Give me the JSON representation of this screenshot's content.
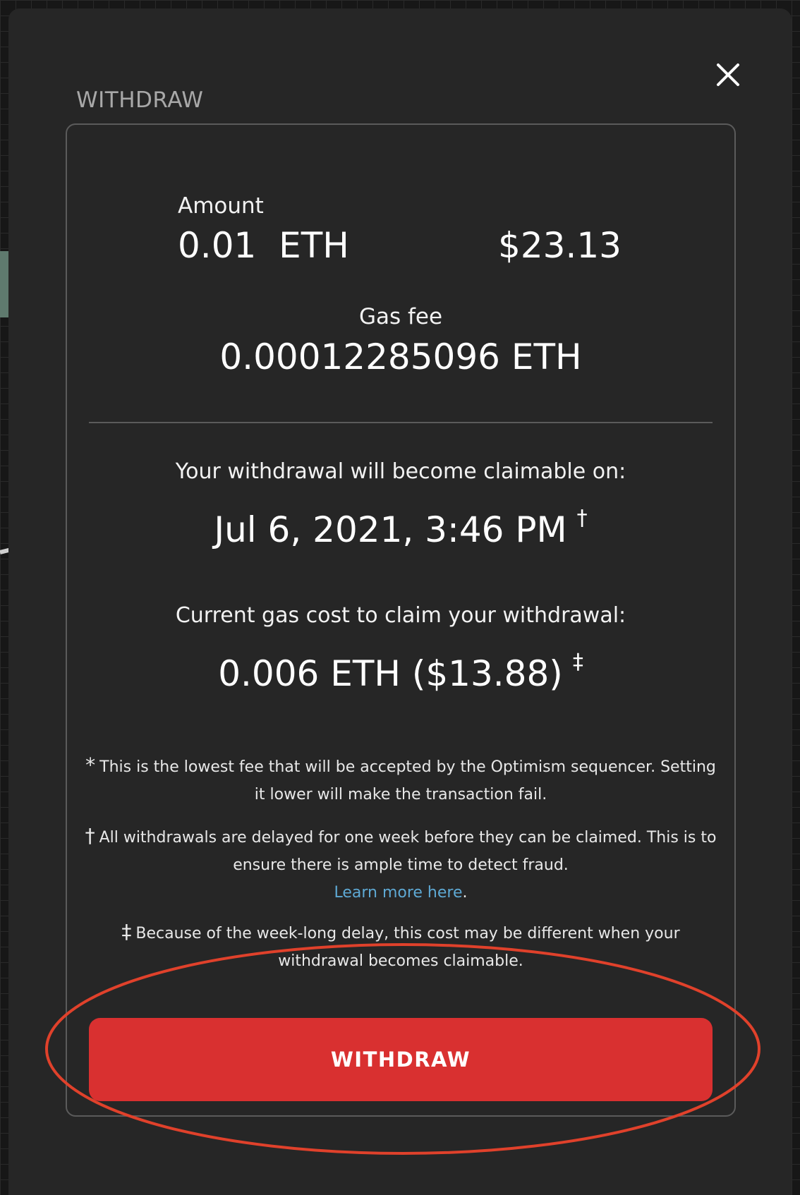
{
  "modal": {
    "title": "WITHDRAW"
  },
  "amount": {
    "label": "Amount",
    "eth": "0.01  ETH",
    "usd": "$23.13"
  },
  "gas_fee": {
    "label": "Gas fee",
    "value": "0.00012285096 ETH"
  },
  "claimable": {
    "label": "Your withdrawal will become claimable on:",
    "date": "Jul 6, 2021, 3:46 PM",
    "mark": "†"
  },
  "claim_gas": {
    "label": "Current gas cost to claim your withdrawal:",
    "value": "0.006 ETH ($13.88)",
    "mark": "‡"
  },
  "notes": {
    "note1_mark": "*",
    "note1_text": "This is the lowest fee that will be accepted by the Optimism sequencer. Setting it lower will make the transaction fail.",
    "note2_mark": "†",
    "note2_text": "All withdrawals are delayed for one week before they can be claimed. This is to ensure there is ample time to detect fraud.",
    "note2_link": "Learn more here",
    "note2_period": ".",
    "note3_mark": "‡",
    "note3_text": "Because of the week-long delay, this cost may be different when your withdrawal becomes claimable."
  },
  "button": {
    "withdraw_label": "WITHDRAW"
  },
  "colors": {
    "button_red": "#d93030",
    "link_blue": "#5ea9d4",
    "annotation_red": "#e0412b"
  }
}
